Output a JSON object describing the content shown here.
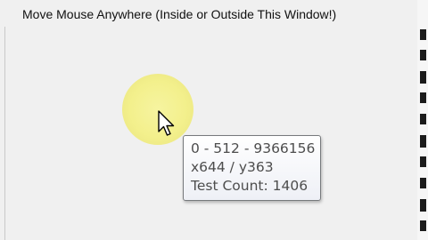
{
  "window": {
    "title": "Move Mouse Anywhere (Inside or Outside This Window!)"
  },
  "cursor": {
    "icon": "arrow-pointer-icon",
    "halo_color": "#f3f08c"
  },
  "tooltip": {
    "line1": "0 - 512 - 9366156",
    "line2": "x644 / y363",
    "line3": "Test Count: 1406"
  }
}
